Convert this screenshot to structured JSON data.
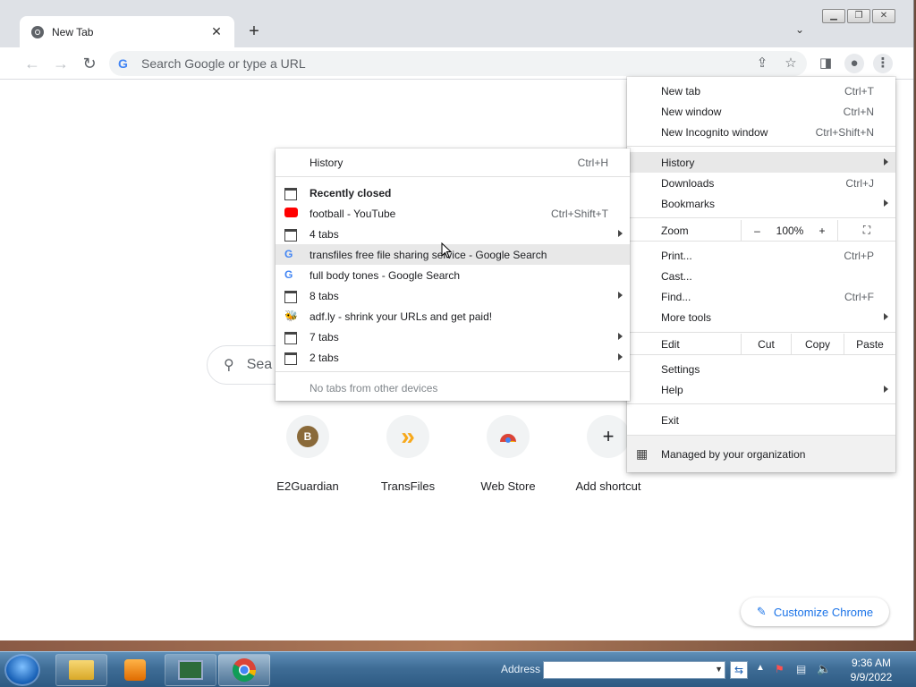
{
  "tab": {
    "title": "New Tab",
    "close": "✕",
    "new_tab": "+"
  },
  "omnibox": {
    "placeholder": "Search Google or type a URL"
  },
  "ntp": {
    "search_placeholder": "Sea",
    "shortcuts": [
      {
        "label": "E2Guardian",
        "glyph": "B"
      },
      {
        "label": "TransFiles",
        "glyph": "»"
      },
      {
        "label": "Web Store",
        "glyph": ""
      },
      {
        "label": "Add shortcut",
        "glyph": "+"
      }
    ],
    "customize": "Customize Chrome"
  },
  "main_menu": {
    "new_tab": {
      "label": "New tab",
      "shortcut": "Ctrl+T"
    },
    "new_window": {
      "label": "New window",
      "shortcut": "Ctrl+N"
    },
    "incognito": {
      "label": "New Incognito window",
      "shortcut": "Ctrl+Shift+N"
    },
    "history": {
      "label": "History"
    },
    "downloads": {
      "label": "Downloads",
      "shortcut": "Ctrl+J"
    },
    "bookmarks": {
      "label": "Bookmarks"
    },
    "zoom": {
      "label": "Zoom",
      "minus": "–",
      "value": "100%",
      "plus": "+"
    },
    "print": {
      "label": "Print...",
      "shortcut": "Ctrl+P"
    },
    "cast": {
      "label": "Cast..."
    },
    "find": {
      "label": "Find...",
      "shortcut": "Ctrl+F"
    },
    "more_tools": {
      "label": "More tools"
    },
    "edit": {
      "label": "Edit",
      "cut": "Cut",
      "copy": "Copy",
      "paste": "Paste"
    },
    "settings": {
      "label": "Settings"
    },
    "help": {
      "label": "Help"
    },
    "exit": {
      "label": "Exit"
    },
    "managed": {
      "label": "Managed by your organization"
    }
  },
  "history_menu": {
    "history": {
      "label": "History",
      "shortcut": "Ctrl+H"
    },
    "recently_closed": "Recently closed",
    "items": [
      {
        "label": "football - YouTube",
        "shortcut": "Ctrl+Shift+T",
        "icon": "youtube-icon"
      },
      {
        "label": "4 tabs",
        "shortcut": "",
        "icon": "tabs-icon"
      },
      {
        "label": "transfiles free file sharing service - Google Search",
        "shortcut": "",
        "icon": "google-icon"
      },
      {
        "label": "full body tones - Google Search",
        "shortcut": "",
        "icon": "google-icon"
      },
      {
        "label": "8 tabs",
        "shortcut": "",
        "icon": "tabs-icon"
      },
      {
        "label": "adf.ly - shrink your URLs and get paid!",
        "shortcut": "",
        "icon": "adfly-icon"
      },
      {
        "label": "7 tabs",
        "shortcut": "",
        "icon": "tabs-icon"
      },
      {
        "label": "2 tabs",
        "shortcut": "",
        "icon": "tabs-icon"
      }
    ],
    "no_tabs": "No tabs from other devices"
  },
  "taskbar": {
    "address_label": "Address",
    "time": "9:36 AM",
    "date": "9/9/2022"
  },
  "colors": {
    "accent": "#1a73e8",
    "menu_highlight": "#e8e8e8",
    "tabstrip": "#dee1e6"
  }
}
